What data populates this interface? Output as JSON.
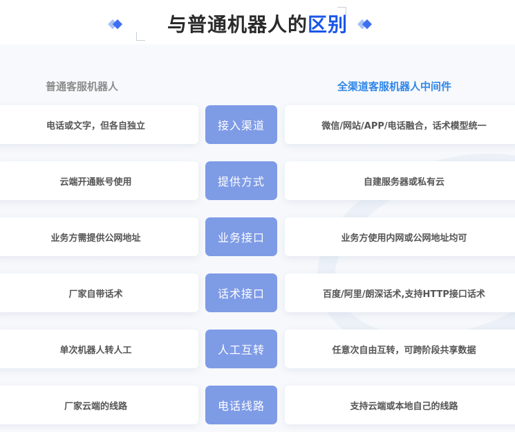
{
  "header": {
    "title_main": "与普通机器人的",
    "title_accent": "区别"
  },
  "columns": {
    "left_heading": "普通客服机器人",
    "right_heading": "全渠道客服机器人中间件"
  },
  "rows": [
    {
      "left": "电话或文字，但各自独立",
      "center": "接入渠道",
      "right": "微信/网站/APP/电话融合，话术模型统一"
    },
    {
      "left": "云端开通账号使用",
      "center": "提供方式",
      "right": "自建服务器或私有云"
    },
    {
      "left": "业务方需提供公网地址",
      "center": "业务接口",
      "right": "业务方使用内网或公网地址均可"
    },
    {
      "left": "厂家自带话术",
      "center": "话术接口",
      "right": "百度/阿里/朗深话术,支持HTTP接口话术"
    },
    {
      "left": "单次机器人转人工",
      "center": "人工互转",
      "right": "任意次自由互转，可跨阶段共享数据"
    },
    {
      "left": "厂家云端的线路",
      "center": "电话线路",
      "right": "支持云端或本地自己的线路"
    }
  ],
  "colors": {
    "accent": "#1a56e8",
    "right_heading": "#2f86e8",
    "pill": "#7e9be6"
  }
}
